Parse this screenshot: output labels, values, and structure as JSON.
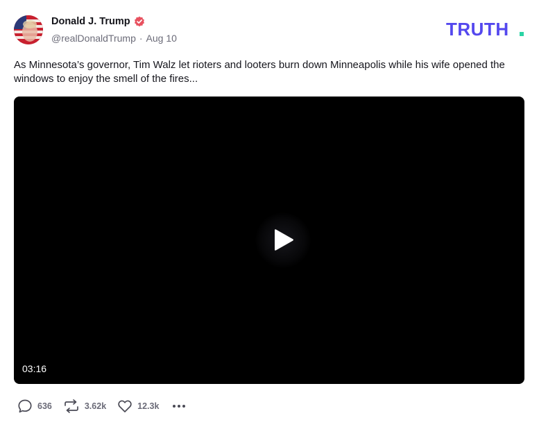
{
  "author": {
    "display_name": "Donald J. Trump",
    "handle": "@realDonaldTrump",
    "separator": "·",
    "date": "Aug 10",
    "verified_icon": "verified-badge-icon",
    "verified_color": "#e8515f"
  },
  "brand": {
    "logo_text": "TRUTH",
    "logo_dot": ".",
    "logo_color": "#5448ee",
    "dot_color": "#2bd4a5"
  },
  "post": {
    "text": "As Minnesota’s governor, Tim Walz let rioters and looters burn down Minneapolis while his wife opened the windows to enjoy the smell of the fires..."
  },
  "video": {
    "duration": "03:16",
    "play_icon": "play-icon"
  },
  "actions": {
    "replies": "636",
    "retruths": "3.62k",
    "likes": "12.3k",
    "reply_icon": "reply-icon",
    "retruth_icon": "retruth-icon",
    "like_icon": "heart-icon",
    "more_icon": "more-icon"
  }
}
